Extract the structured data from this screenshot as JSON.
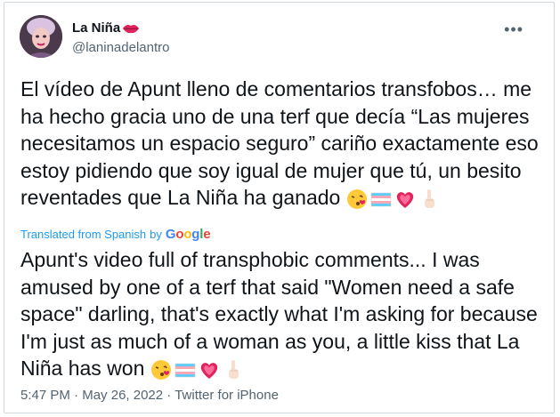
{
  "author": {
    "display_name": "La Niña",
    "handle": "@laninadelantro"
  },
  "tweet": {
    "original_text": "El vídeo de Apunt lleno de comentarios transfobos… me ha hecho gracia uno de una terf que decía “Las mujeres necesitamos un espacio seguro” cariño exactamente eso estoy pidiendo que soy igual de mujer que tú, un besito reventades que La Niña ha ganado",
    "translated_label": "Translated from Spanish",
    "translated_by": "by",
    "translator_brand": "Google",
    "translated_text": "Apunt's video full of transphobic comments... I was amused by one of a terf that said \"Women need a safe space\" darling, that's exactly what I'm asking for because I'm just as much of a woman as you, a little kiss that La Niña has won",
    "emojis": [
      "kissing-face-emoji",
      "transgender-flag-emoji",
      "growing-heart-emoji",
      "pointing-up-emoji"
    ]
  },
  "meta": {
    "time": "5:47 PM",
    "date": "May 26, 2022",
    "source": "Twitter for iPhone",
    "separator": "·"
  },
  "more_icon": "more-options-icon",
  "colors": {
    "link": "#1d9bf0",
    "secondary": "#536471",
    "text": "#0f1419",
    "border": "#cfd9de"
  }
}
